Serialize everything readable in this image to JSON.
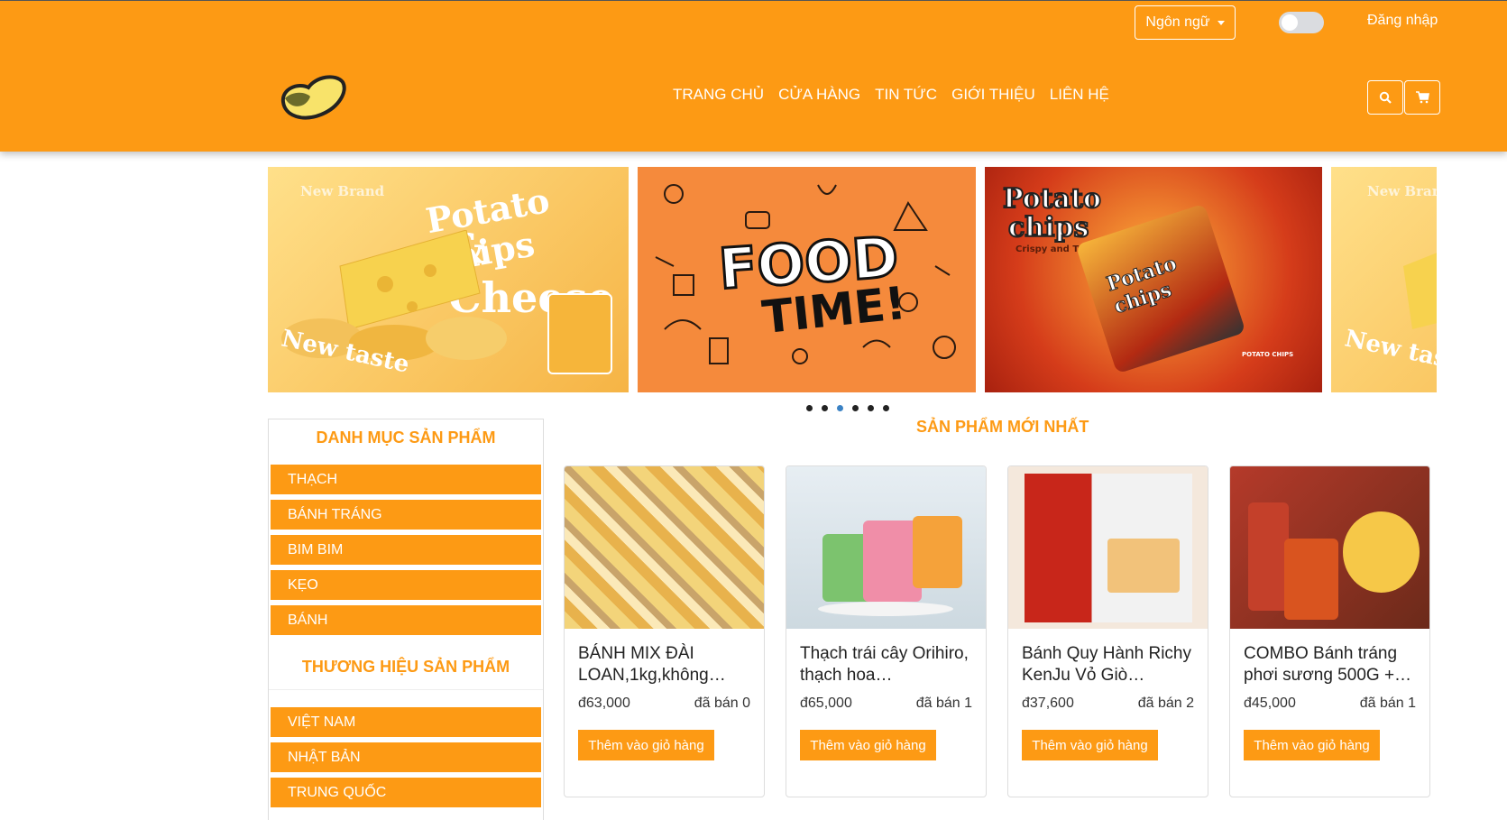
{
  "header": {
    "language_label": "Ngôn ngữ",
    "login_label": "Đăng nhập",
    "nav": [
      "TRANG CHỦ",
      "CỬA HÀNG",
      "TIN TỨC",
      "GIỚI THIỆU",
      "LIÊN HỆ"
    ],
    "search_icon": "search-icon",
    "cart_icon": "cart-icon"
  },
  "banners": [
    {
      "line1": "Potato chips",
      "line2": "& Cheese",
      "brand": "New Brand",
      "tag": "New taste"
    },
    {
      "line1": "FOOD",
      "line2": "TIME!"
    },
    {
      "line1": "Potato",
      "line2": "chips",
      "sub": "Crispy and Tasty",
      "pack": "Potato chips",
      "footer": "POTATO CHIPS"
    },
    {
      "brand": "New Brand",
      "tag": "New taste"
    }
  ],
  "carousel": {
    "count": 6,
    "active": 2
  },
  "sidebar": {
    "category_title": "DANH MỤC SẢN PHẨM",
    "categories": [
      "THẠCH",
      "BÁNH TRÁNG",
      "BIM BIM",
      "KẸO",
      "BÁNH"
    ],
    "brand_title": "THƯƠNG HIỆU SẢN PHẨM",
    "brands": [
      "VIỆT NAM",
      "NHẬT BẢN",
      "TRUNG QUỐC"
    ]
  },
  "products": {
    "section_title": "SẢN PHẨM MỚI NHẤT",
    "add_label": "Thêm vào giỏ hàng",
    "items": [
      {
        "name": "BÁNH MIX ĐÀI LOAN,1kg,không…",
        "price": "đ63,000",
        "sold": "đã bán 0"
      },
      {
        "name": "Thạch trái cây Orihiro, thạch hoa…",
        "price": "đ65,000",
        "sold": "đã bán 1"
      },
      {
        "name": "Bánh Quy Hành Richy KenJu Vỏ Giò…",
        "price": "đ37,600",
        "sold": "đã bán 2"
      },
      {
        "name": "COMBO Bánh tráng phơi sương 500G +…",
        "price": "đ45,000",
        "sold": "đã bán 1"
      }
    ]
  },
  "colors": {
    "brand": "#fd9a14",
    "dot_active": "#3b82c4"
  }
}
